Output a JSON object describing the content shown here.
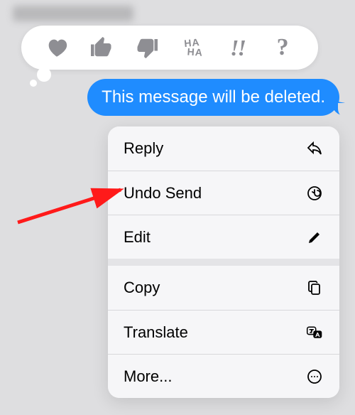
{
  "reactions": {
    "heart": "heart",
    "thumbs_up": "thumbs-up",
    "thumbs_down": "thumbs-down",
    "haha_line1": "HA",
    "haha_line2": "HA",
    "exclaim": "!!",
    "question": "?"
  },
  "message": {
    "text": "This message will be deleted."
  },
  "menu": {
    "reply": "Reply",
    "undo_send": "Undo Send",
    "edit": "Edit",
    "copy": "Copy",
    "translate": "Translate",
    "more": "More..."
  },
  "colors": {
    "bubble": "#1f8cff",
    "background": "#dedee0",
    "reaction_gray": "#8e8e93",
    "arrow": "#ff1a1a"
  }
}
